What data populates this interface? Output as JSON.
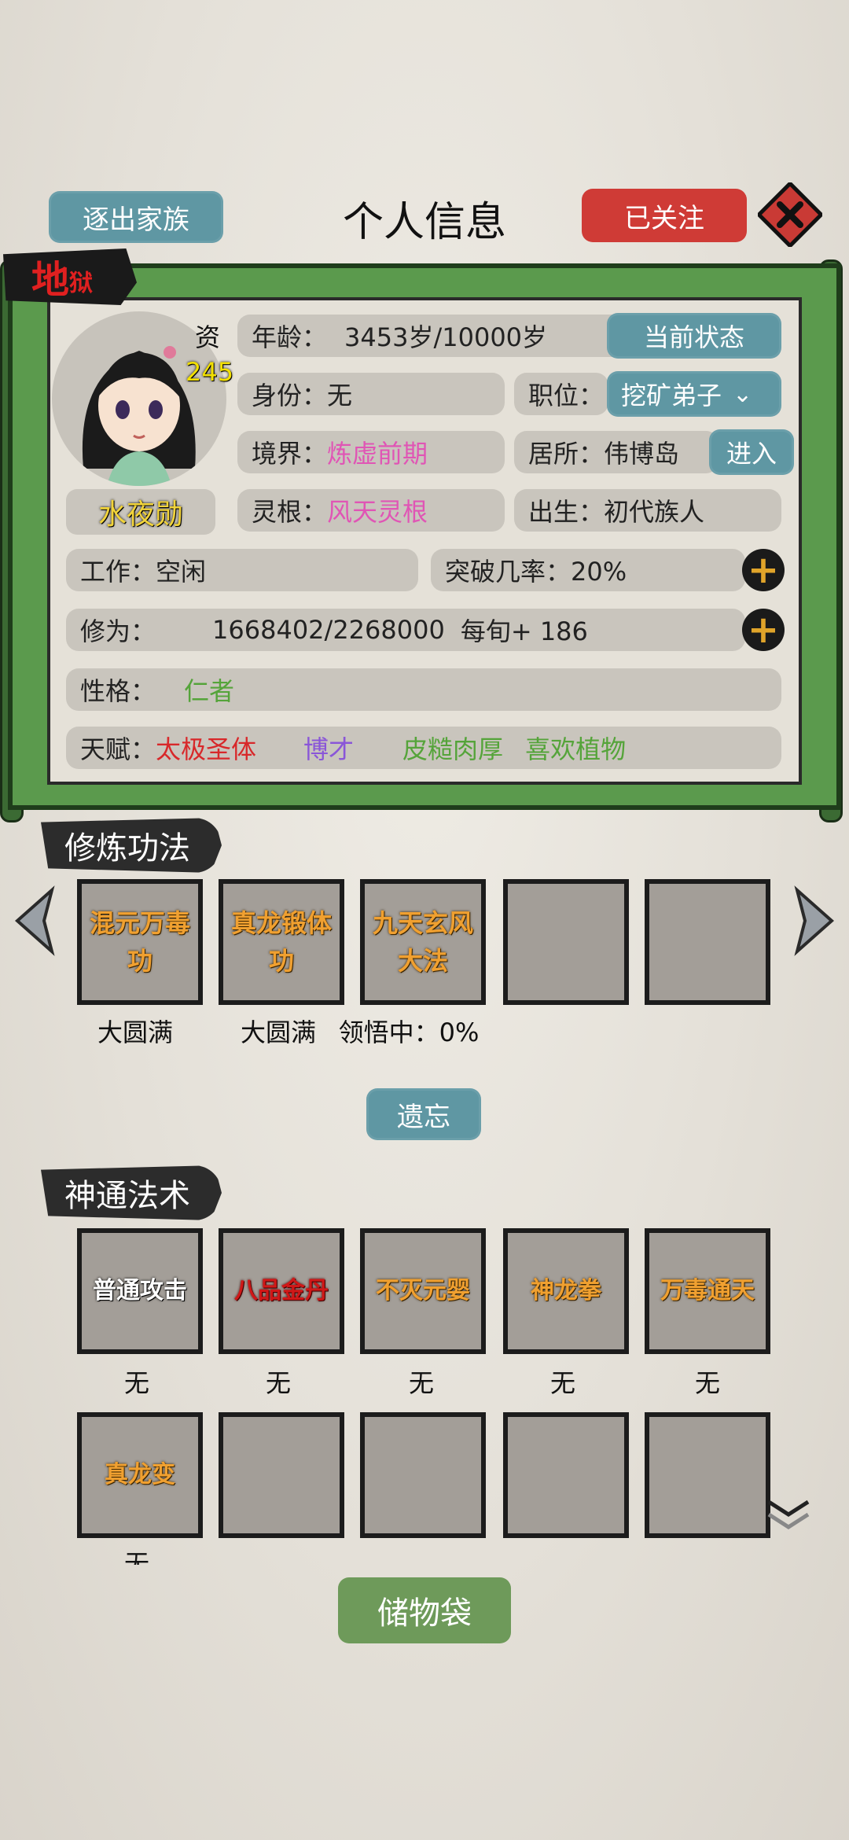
{
  "header": {
    "title": "个人信息",
    "expel_label": "逐出家族",
    "follow_label": "已关注",
    "close_icon": "close-icon"
  },
  "badge": {
    "main": "地",
    "sub": "狱"
  },
  "character": {
    "name": "水夜勋",
    "aptitude_label": "资",
    "aptitude_value": "245"
  },
  "info": {
    "age_label": "年龄：",
    "age_value": "3453岁/10000岁",
    "status_button": "当前状态",
    "identity": "身份：无",
    "position_label": "职位：",
    "position_value": "挖矿弟子",
    "realm_label": "境界：",
    "realm_value": "炼虚前期",
    "residence_label": "居所：",
    "residence_value": "伟博岛",
    "enter_button": "进入",
    "root_label": "灵根：",
    "root_value": "风天灵根",
    "birth_label": "出生：",
    "birth_value": "初代族人",
    "work": "工作：空闲",
    "breakthrough": "突破几率：20%",
    "cultivation_label": "修为：",
    "cultivation_value": "1668402/2268000",
    "cultivation_rate": "每旬+ 186",
    "personality_label": "性格：",
    "personality_value": "仁者",
    "talent_label": "天赋：",
    "talents": [
      "太极圣体",
      "博才",
      "皮糙肉厚",
      "喜欢植物"
    ]
  },
  "techniques": {
    "title": "修炼功法",
    "slots": [
      {
        "name": "混元万毒功",
        "status": "大圆满"
      },
      {
        "name": "真龙锻体功",
        "status": "大圆满"
      },
      {
        "name": "九天玄风大法",
        "status": "领悟中：0%"
      },
      {
        "name": "",
        "status": ""
      },
      {
        "name": "",
        "status": ""
      }
    ],
    "forget_label": "遗忘"
  },
  "skills": {
    "title": "神通法术",
    "row1": [
      {
        "name": "普通攻击",
        "status": "无"
      },
      {
        "name": "八品金丹",
        "status": "无"
      },
      {
        "name": "不灭元婴",
        "status": "无"
      },
      {
        "name": "神龙拳",
        "status": "无"
      },
      {
        "name": "万毒通天",
        "status": "无"
      }
    ],
    "row2": [
      {
        "name": "真龙变",
        "status": "无"
      }
    ]
  },
  "footer": {
    "storage_label": "储物袋"
  }
}
